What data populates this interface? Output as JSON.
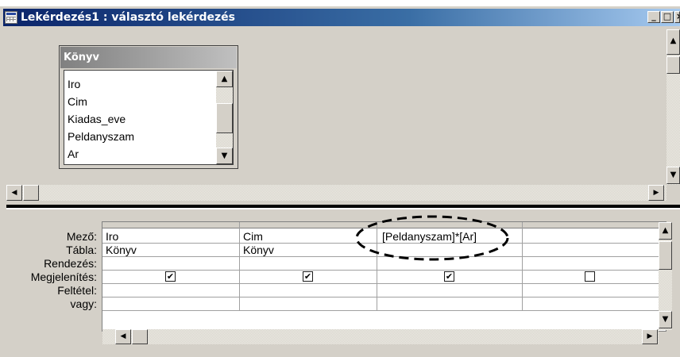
{
  "window": {
    "title": "Lekérdezés1 : választó lekérdezés",
    "minimize_glyph": "_",
    "maximize_glyph": "□",
    "close_glyph": "×"
  },
  "field_list": {
    "table_name": "Könyv",
    "fields": [
      "Iro",
      "Cim",
      "Kiadas_eve",
      "Peldanyszam",
      "Ar"
    ]
  },
  "grid": {
    "row_labels": [
      "Mező:",
      "Tábla:",
      "Rendezés:",
      "Megjelenítés:",
      "Feltétel:",
      "vagy:"
    ],
    "columns": [
      {
        "field": "Iro",
        "table": "Könyv",
        "sort": "",
        "show": true
      },
      {
        "field": "Cim",
        "table": "Könyv",
        "sort": "",
        "show": true
      },
      {
        "field": "[Peldanyszam]*[Ar]",
        "table": "",
        "sort": "",
        "show": true
      },
      {
        "field": "",
        "table": "",
        "sort": "",
        "show": false
      }
    ]
  },
  "glyphs": {
    "up": "▲",
    "down": "▼",
    "left": "◀",
    "right": "▶",
    "check": "✔"
  },
  "icons": {
    "title_icon": "query-icon",
    "highlight": "dashed-ellipse-annotation"
  }
}
